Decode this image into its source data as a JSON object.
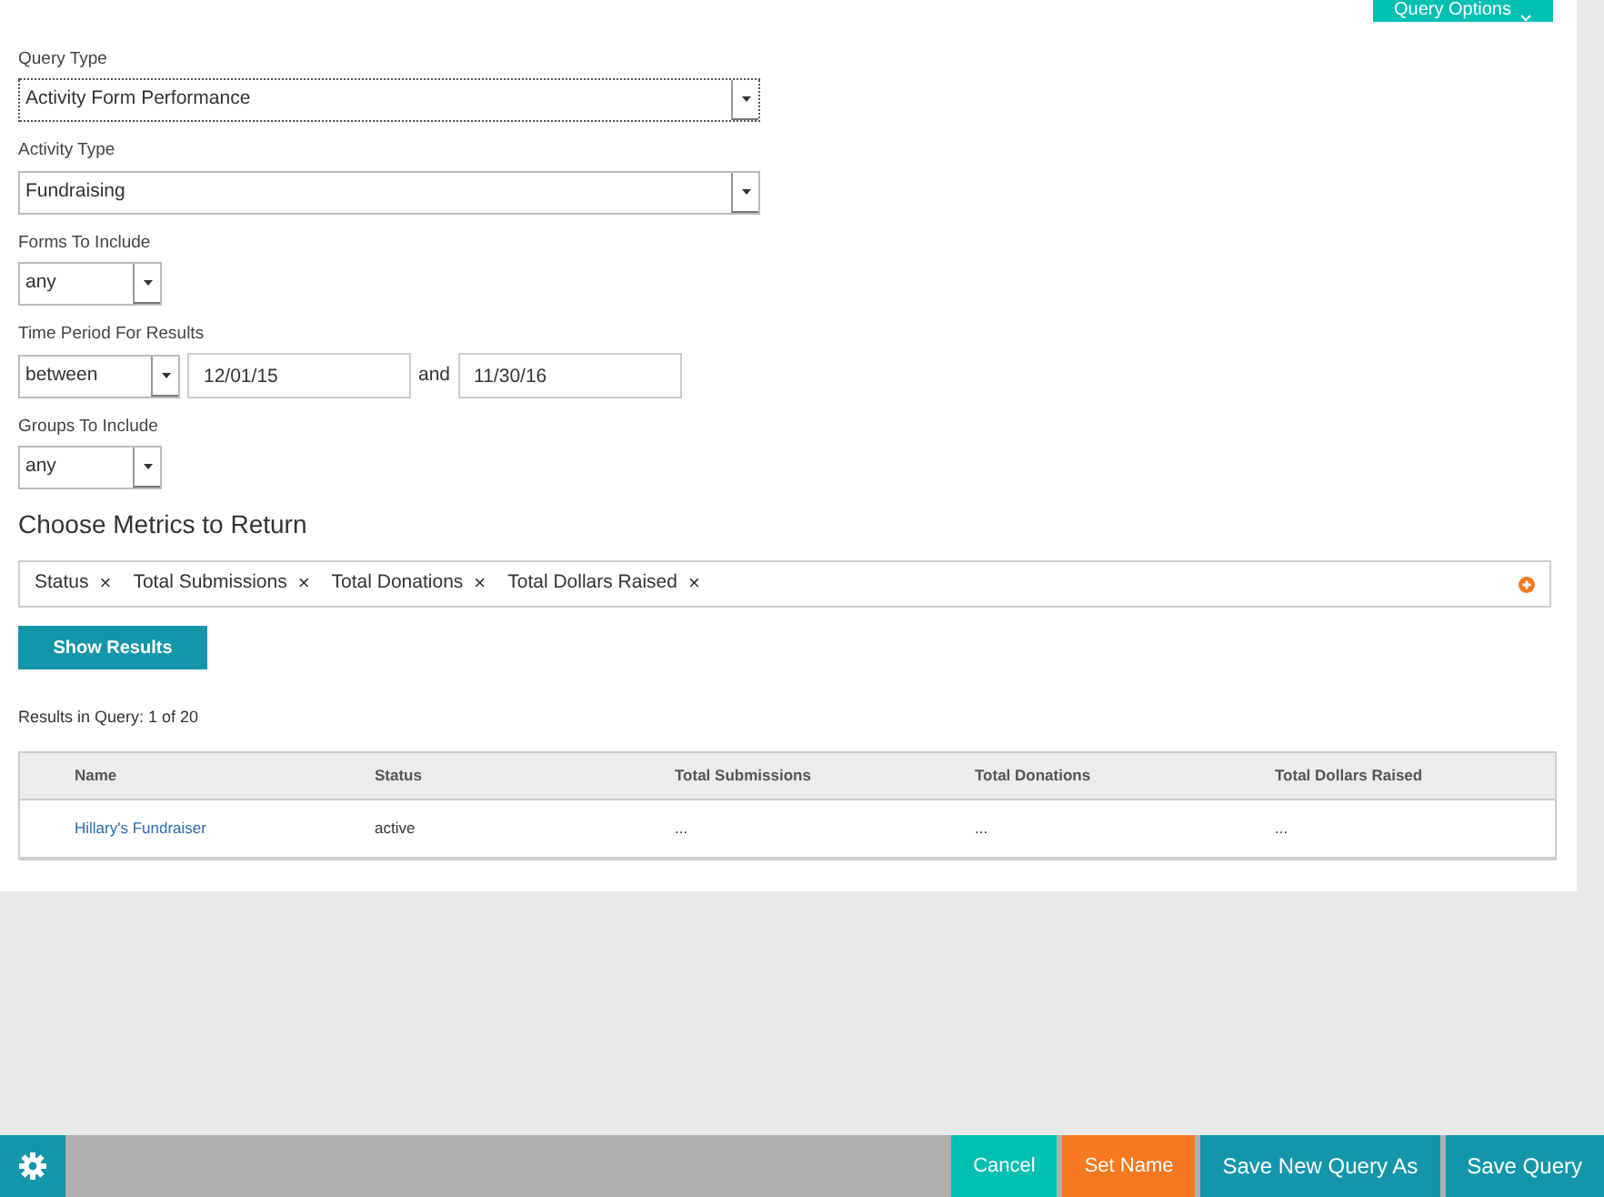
{
  "query_options_button": "Query Options",
  "fields": [
    {
      "label": "Query Type",
      "value": "Activity Form Performance",
      "kind": "wide",
      "focused": true
    },
    {
      "label": "Activity Type",
      "value": "Fundraising",
      "kind": "wide",
      "focused": false
    },
    {
      "label": "Forms To Include",
      "value": "any",
      "kind": "small",
      "focused": false
    }
  ],
  "time_period": {
    "label": "Time Period For Results",
    "operator": "between",
    "start": "12/01/15",
    "joiner": "and",
    "end": "11/30/16"
  },
  "groups": {
    "label": "Groups To Include",
    "value": "any"
  },
  "metrics": {
    "heading": "Choose Metrics to Return",
    "tags": [
      "Status",
      "Total Submissions",
      "Total Donations",
      "Total Dollars Raised"
    ],
    "remove_symbol": "×"
  },
  "show_results_button": "Show Results",
  "results_count": "Results in Query: 1 of 20",
  "table": {
    "columns": [
      "Name",
      "Status",
      "Total Submissions",
      "Total Donations",
      "Total Dollars Raised"
    ],
    "rows": [
      [
        "Hillary's Fundraiser",
        "active",
        "...",
        "...",
        "..."
      ]
    ]
  },
  "footer": {
    "buttons": [
      {
        "label": "Cancel",
        "kind": "cancel"
      },
      {
        "label": "Set Name",
        "kind": "name"
      },
      {
        "label": "Save New Query As",
        "kind": "save"
      },
      {
        "label": "Save Query",
        "kind": "save"
      }
    ]
  }
}
